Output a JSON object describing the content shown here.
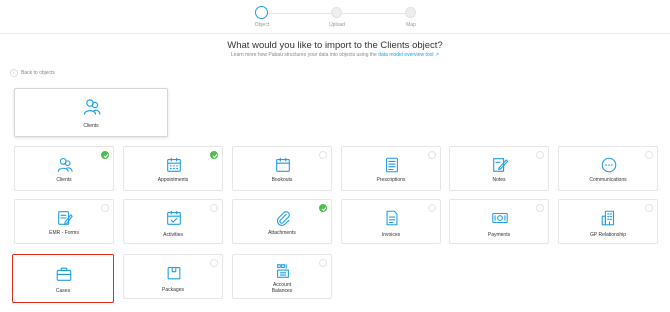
{
  "stepper": {
    "steps": [
      {
        "label": "Object"
      },
      {
        "label": "Upload"
      },
      {
        "label": "Map"
      }
    ]
  },
  "header": {
    "title": "What would you like to import to the Clients object?",
    "subtitle_text": "Learn more how Pabau structures your data into objects using the",
    "subtitle_link": "data model overview tool"
  },
  "back_link": {
    "label": "Back to objects"
  },
  "selected_object": {
    "label": "Clients",
    "icon": "clients-icon"
  },
  "objects": [
    {
      "label": "Clients",
      "icon": "clients-icon",
      "checked": true
    },
    {
      "label": "Appointments",
      "icon": "calendar-icon",
      "checked": true
    },
    {
      "label": "Bookouts",
      "icon": "calendar-blank-icon",
      "checked": false
    },
    {
      "label": "Prescriptions",
      "icon": "prescription-icon",
      "checked": false
    },
    {
      "label": "Notes",
      "icon": "notes-icon",
      "checked": false
    },
    {
      "label": "Communications",
      "icon": "chat-icon",
      "checked": false
    },
    {
      "label": "EMR - Forms",
      "icon": "form-icon",
      "checked": false
    },
    {
      "label": "Activities",
      "icon": "activities-icon",
      "checked": false
    },
    {
      "label": "Attachments",
      "icon": "paperclip-icon",
      "checked": true
    },
    {
      "label": "Invoices",
      "icon": "invoice-icon",
      "checked": false
    },
    {
      "label": "Payments",
      "icon": "payment-icon",
      "checked": false
    },
    {
      "label": "GP Relationship",
      "icon": "building-icon",
      "checked": false
    },
    {
      "label": "Cases",
      "icon": "briefcase-icon",
      "checked": false
    },
    {
      "label": "Packages",
      "icon": "package-icon",
      "checked": false
    },
    {
      "label": "Account\nBalances",
      "icon": "balance-icon",
      "checked": false
    }
  ],
  "colors": {
    "accent": "#1e9ee6",
    "check": "#4cbf4c",
    "highlight": "#e0281e"
  }
}
